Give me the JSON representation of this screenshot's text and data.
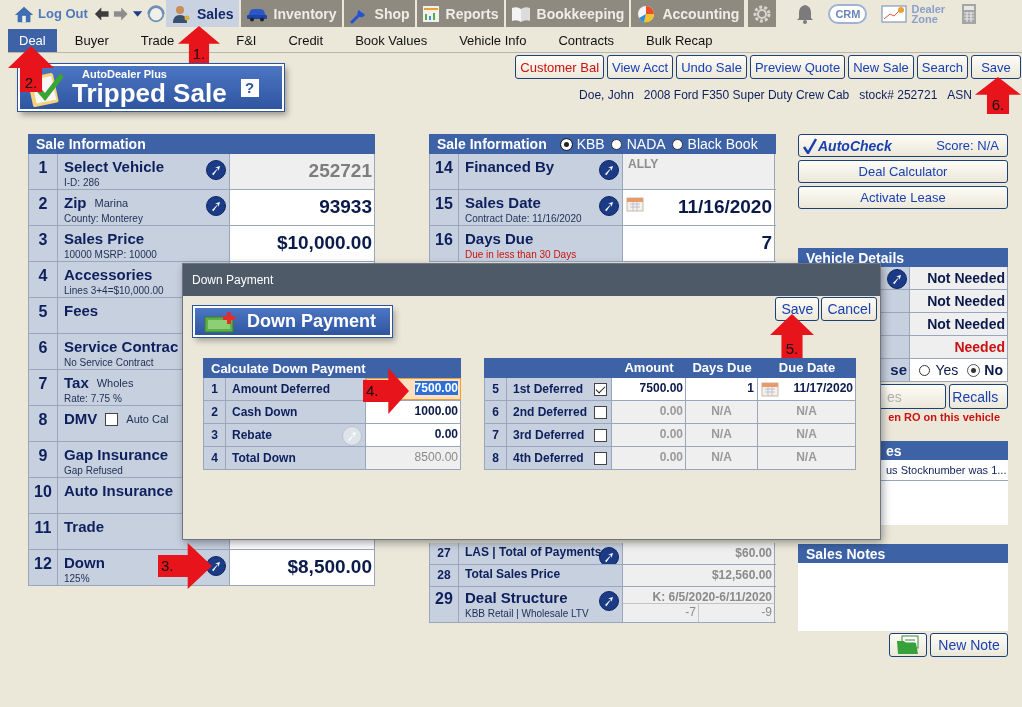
{
  "top_nav": {
    "logout": "Log Out",
    "modules": [
      {
        "label": "Sales",
        "kind": "person",
        "selected": true
      },
      {
        "label": "Inventory",
        "kind": "car",
        "selected": false
      },
      {
        "label": "Shop",
        "kind": "wrench",
        "selected": false
      },
      {
        "label": "Reports",
        "kind": "report",
        "selected": false
      },
      {
        "label": "Bookkeeping",
        "kind": "book",
        "selected": false
      },
      {
        "label": "Accounting",
        "kind": "pie",
        "selected": false
      }
    ],
    "crm": "CRM",
    "dealer_zone": "Dealer Zone"
  },
  "subtabs": [
    {
      "label": "Deal",
      "selected": true
    },
    {
      "label": "Buyer",
      "selected": false
    },
    {
      "label": "Trade",
      "selected": false
    },
    {
      "label": "F&I",
      "selected": false
    },
    {
      "label": "Credit",
      "selected": false
    },
    {
      "label": "Book Values",
      "selected": false
    },
    {
      "label": "Vehicle Info",
      "selected": false
    },
    {
      "label": "Contracts",
      "selected": false
    },
    {
      "label": "Bulk Recap",
      "selected": false
    }
  ],
  "banner": {
    "brand": "AutoDealer Plus",
    "title": "Tripped Sale",
    "help": "?"
  },
  "actions": [
    {
      "label": "Customer Bal",
      "alert": true
    },
    {
      "label": "View Acct",
      "alert": false
    },
    {
      "label": "Undo Sale",
      "alert": false
    },
    {
      "label": "Preview Quote",
      "alert": false
    },
    {
      "label": "New Sale",
      "alert": false
    },
    {
      "label": "Search",
      "alert": false
    },
    {
      "label": "Save",
      "alert": false
    }
  ],
  "deal_summary": [
    "Doe,  John",
    "2008 Ford F350 Super Duty Crew Cab",
    "stock# 252721",
    "ASN"
  ],
  "sale_info": {
    "title": "Sale Information",
    "rows": [
      {
        "number": "1",
        "label": "Select Vehicle",
        "sub": "I-D:  286",
        "link": true,
        "value": "252721",
        "kind": "readonly"
      },
      {
        "number": "2",
        "label": "Zip",
        "aside": "Marina",
        "sub": "County:  Monterey",
        "link": true,
        "value": "93933",
        "kind": "input"
      },
      {
        "number": "3",
        "label": "Sales Price",
        "sub": "10000 MSRP: 10000",
        "link": false,
        "value": "$10,000.00",
        "kind": "input"
      },
      {
        "number": "4",
        "label": "Accessories",
        "sub": "Lines 3+4=$10,000.00",
        "kind": "input"
      },
      {
        "number": "5",
        "label": "Fees",
        "kind": "input"
      },
      {
        "number": "6",
        "label": "Service Contrac",
        "sub": "No Service Contract",
        "kind": "input"
      },
      {
        "number": "7",
        "label": "Tax",
        "aside": "Wholes",
        "sub": "Rate: 7.75 %",
        "kind": "input"
      },
      {
        "number": "8",
        "label": "DMV",
        "checked": false,
        "aside": "Auto Cal",
        "kind": "input"
      },
      {
        "number": "9",
        "label": "Gap Insurance",
        "sub": "Gap Refused",
        "kind": "input"
      },
      {
        "number": "10",
        "label": "Auto Insurance",
        "kind": "input"
      },
      {
        "number": "11",
        "label": "Trade",
        "kind": "input"
      },
      {
        "number": "12",
        "label": "Down",
        "sub": "125%",
        "link": true,
        "value": "$8,500.00",
        "kind": "input"
      }
    ]
  },
  "finance_info": {
    "title": "Sale Information",
    "book_options": [
      {
        "label": "KBB",
        "selected": true
      },
      {
        "label": "NADA",
        "selected": false
      },
      {
        "label": "Black Book",
        "selected": false
      }
    ],
    "rows_top": [
      {
        "number": "14",
        "label": "Financed By",
        "link": true,
        "value": "ALLY",
        "kind": "lender"
      },
      {
        "number": "15",
        "label": "Sales Date",
        "sub": "Contract Date:  11/16/2020",
        "link": true,
        "value": "11/16/2020",
        "kind": "date"
      },
      {
        "number": "16",
        "label": "Days Due",
        "sub": "Due in less than 30 Days",
        "sub_alert": true,
        "link": false,
        "value": "7",
        "kind": "input"
      }
    ],
    "rows_bottom": [
      {
        "number": "27",
        "label": "LAS | Total of Payments",
        "link": true,
        "value": "$60.00"
      },
      {
        "number": "28",
        "label": "Total Sales Price",
        "link": false,
        "value": "$12,560.00"
      },
      {
        "number": "29",
        "label": "Deal Structure",
        "sub": "KBB Retail | Wholesale LTV",
        "link": true,
        "value": "K: 6/5/2020-6/11/2020",
        "split": [
          "-7",
          "-9"
        ]
      }
    ]
  },
  "autocheck": {
    "brand": "AutoCheck",
    "score": "Score:  N/A"
  },
  "side_buttons": [
    "Deal Calculator",
    "Activate Lease"
  ],
  "vehicle_details": {
    "title": "Vehicle Details",
    "rows": [
      {
        "link": true,
        "status": "Not Needed",
        "needed": false
      },
      {
        "link": false,
        "status": "Not Needed",
        "needed": false
      },
      {
        "link": false,
        "status": "Not Needed",
        "needed": false
      },
      {
        "link": false,
        "status": "Needed",
        "needed": true
      }
    ],
    "lease_label": "se",
    "lease_options": [
      {
        "label": "Yes",
        "selected": false
      },
      {
        "label": "No",
        "selected": true
      }
    ],
    "buttons": [
      {
        "label": "es",
        "disabled": true
      },
      {
        "label": "Recalls",
        "disabled": false
      }
    ],
    "warning": "en RO on this vehicle"
  },
  "notes_panel": {
    "title": "es",
    "entries": [
      "us Stocknumber was 1..."
    ]
  },
  "sales_notes": {
    "title": "Sales Notes",
    "new_note": "New Note"
  },
  "dialog": {
    "title": "Down Payment",
    "heading": "Down Payment",
    "buttons": [
      "Save",
      "Cancel"
    ],
    "calc": {
      "title": "Calculate Down Payment",
      "rows": [
        {
          "number": "1",
          "label": "Amount Deferred",
          "value": "7500.00",
          "kind": "input",
          "focused": true
        },
        {
          "number": "2",
          "label": "Cash Down",
          "value": "1000.00",
          "kind": "input",
          "focused": false
        },
        {
          "number": "3",
          "label": "Rebate",
          "value": "0.00",
          "kind": "input",
          "focused": false,
          "lookup": true
        },
        {
          "number": "4",
          "label": "Total Down",
          "value": "8500.00",
          "kind": "readonly",
          "focused": false
        }
      ]
    },
    "deferred": {
      "columns": [
        "Amount",
        "Days Due",
        "Due Date"
      ],
      "rows": [
        {
          "number": "5",
          "label": "1st Deferred",
          "checked": true,
          "amount": "7500.00",
          "days_due": "1",
          "due_date": "11/17/2020"
        },
        {
          "number": "6",
          "label": "2nd Deferred",
          "checked": false,
          "amount": "0.00",
          "days_due": "N/A",
          "due_date": "N/A"
        },
        {
          "number": "7",
          "label": "3rd Deferred",
          "checked": false,
          "amount": "0.00",
          "days_due": "N/A",
          "due_date": "N/A"
        },
        {
          "number": "8",
          "label": "4th Deferred",
          "checked": false,
          "amount": "0.00",
          "days_due": "N/A",
          "due_date": "N/A"
        }
      ]
    }
  },
  "callouts": [
    {
      "label": "1."
    },
    {
      "label": "2."
    },
    {
      "label": "3."
    },
    {
      "label": "4."
    },
    {
      "label": "5."
    },
    {
      "label": "6."
    }
  ]
}
